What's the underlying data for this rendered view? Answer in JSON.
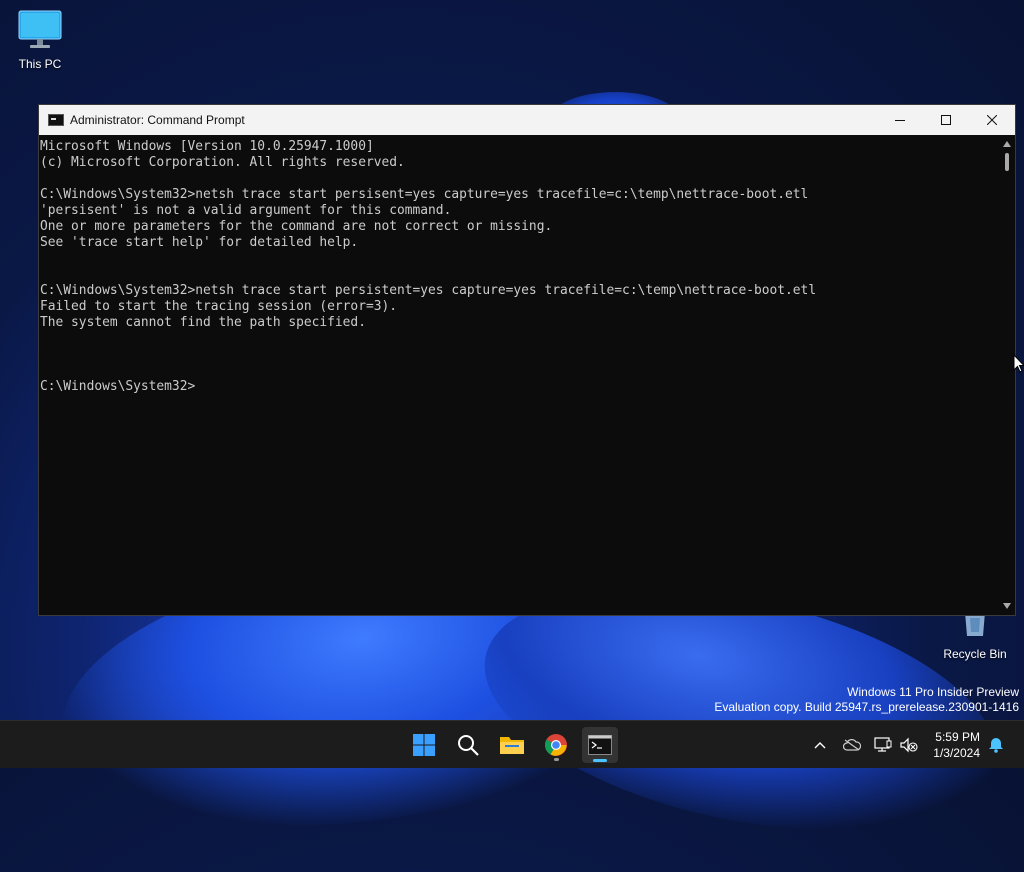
{
  "desktop": {
    "icons": [
      {
        "label": "This PC"
      },
      {
        "label": "Recycle Bin"
      }
    ],
    "watermark": {
      "line1": "Windows 11 Pro Insider Preview",
      "line2": "Evaluation copy. Build 25947.rs_prerelease.230901-1416"
    }
  },
  "window": {
    "title": "Administrator: Command Prompt",
    "console_lines": [
      "Microsoft Windows [Version 10.0.25947.1000]",
      "(c) Microsoft Corporation. All rights reserved.",
      "",
      "C:\\Windows\\System32>netsh trace start persisent=yes capture=yes tracefile=c:\\temp\\nettrace-boot.etl",
      "'persisent' is not a valid argument for this command.",
      "One or more parameters for the command are not correct or missing.",
      "See 'trace start help' for detailed help.",
      "",
      "",
      "C:\\Windows\\System32>netsh trace start persistent=yes capture=yes tracefile=c:\\temp\\nettrace-boot.etl",
      "Failed to start the tracing session (error=3).",
      "The system cannot find the path specified.",
      "",
      "",
      "",
      "C:\\Windows\\System32>"
    ]
  },
  "taskbar": {
    "apps": [
      "start-icon",
      "search-icon",
      "file-explorer-icon",
      "chrome-icon",
      "terminal-icon"
    ],
    "clock": {
      "time": "5:59 PM",
      "date": "1/3/2024"
    }
  },
  "colors": {
    "console_bg": "#0c0c0c",
    "console_fg": "#cccccc",
    "taskbar_bg": "#1c1c1c",
    "accent": "#4cc2ff"
  }
}
